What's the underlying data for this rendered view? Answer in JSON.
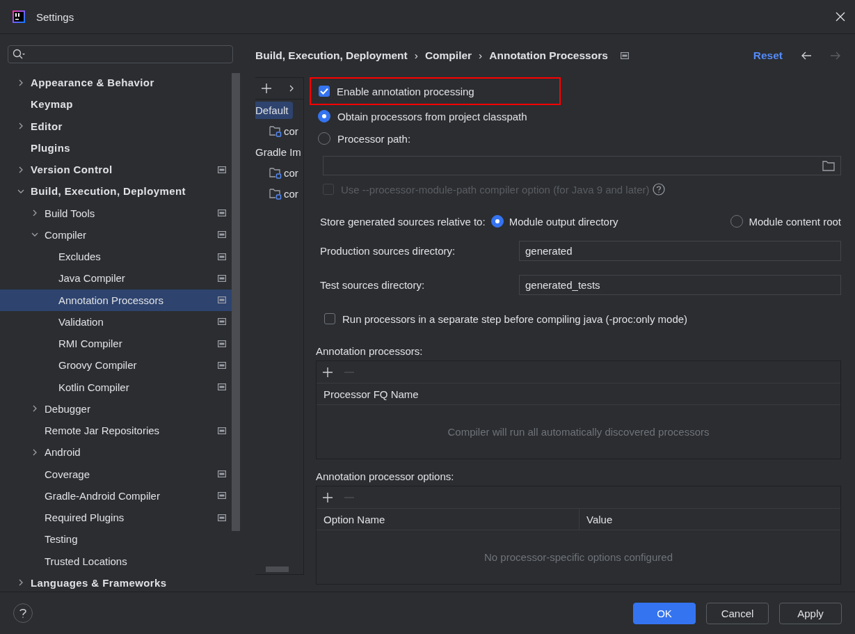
{
  "window": {
    "title": "Settings"
  },
  "sidebar": {
    "items": [
      {
        "label": "Appearance & Behavior",
        "expanded": false,
        "project_level": false,
        "selected": false
      },
      {
        "label": "Keymap",
        "project_level": false,
        "selected": false
      },
      {
        "label": "Editor",
        "expanded": false,
        "project_level": false,
        "selected": false
      },
      {
        "label": "Plugins",
        "project_level": false,
        "selected": false
      },
      {
        "label": "Version Control",
        "expanded": false,
        "project_level": true,
        "selected": false
      },
      {
        "label": "Build, Execution, Deployment",
        "expanded": true,
        "project_level": false,
        "selected": false,
        "children": [
          {
            "label": "Build Tools",
            "expanded": false,
            "project_level": true,
            "selected": false
          },
          {
            "label": "Compiler",
            "expanded": true,
            "project_level": true,
            "selected": false,
            "children": [
              {
                "label": "Excludes",
                "project_level": true,
                "selected": false
              },
              {
                "label": "Java Compiler",
                "project_level": true,
                "selected": false
              },
              {
                "label": "Annotation Processors",
                "project_level": true,
                "selected": true
              },
              {
                "label": "Validation",
                "project_level": true,
                "selected": false
              },
              {
                "label": "RMI Compiler",
                "project_level": true,
                "selected": false
              },
              {
                "label": "Groovy Compiler",
                "project_level": true,
                "selected": false
              },
              {
                "label": "Kotlin Compiler",
                "project_level": true,
                "selected": false
              }
            ]
          },
          {
            "label": "Debugger",
            "expanded": false,
            "project_level": false,
            "selected": false
          },
          {
            "label": "Remote Jar Repositories",
            "project_level": true,
            "selected": false
          },
          {
            "label": "Android",
            "expanded": false,
            "project_level": false,
            "selected": false
          },
          {
            "label": "Coverage",
            "project_level": true,
            "selected": false
          },
          {
            "label": "Gradle-Android Compiler",
            "project_level": true,
            "selected": false
          },
          {
            "label": "Required Plugins",
            "project_level": true,
            "selected": false
          },
          {
            "label": "Testing",
            "project_level": false,
            "selected": false
          },
          {
            "label": "Trusted Locations",
            "project_level": false,
            "selected": false
          }
        ]
      },
      {
        "label": "Languages & Frameworks",
        "expanded": false,
        "project_level": false,
        "selected": false
      }
    ]
  },
  "breadcrumb": {
    "parts": [
      "Build, Execution, Deployment",
      "Compiler",
      "Annotation Processors"
    ],
    "separator": "›",
    "project_level": true
  },
  "reset": "Reset",
  "navigation": {
    "back_disabled": false,
    "forward_disabled": true
  },
  "profiles": [
    {
      "label": "Default",
      "kind": "profile",
      "selected": true
    },
    {
      "label": "cor",
      "kind": "module",
      "selected": false
    },
    {
      "label": "Gradle Im",
      "kind": "profile",
      "selected": false
    },
    {
      "label": "cor",
      "kind": "module",
      "selected": false
    },
    {
      "label": "cor",
      "kind": "module",
      "selected": false
    }
  ],
  "enable_processing": {
    "label": "Enable annotation processing",
    "checked": true,
    "highlighted": true
  },
  "processor_source": [
    {
      "label": "Obtain processors from project classpath",
      "selected": true
    },
    {
      "label": "Processor path:",
      "selected": false
    }
  ],
  "module_path_option": {
    "label": "Use --processor-module-path compiler option (for Java 9 and later)",
    "checked": false,
    "disabled": true
  },
  "store_generated": {
    "label": "Store generated sources relative to:",
    "options": [
      {
        "label": "Module output directory",
        "selected": true
      },
      {
        "label": "Module content root",
        "selected": false
      }
    ]
  },
  "production_dir": {
    "label": "Production sources directory:",
    "value": "generated"
  },
  "test_dir": {
    "label": "Test sources directory:",
    "value": "generated_tests"
  },
  "separate_step": {
    "label": "Run processors in a separate step before compiling java (-proc:only mode)",
    "checked": false
  },
  "processors_table": {
    "title": "Annotation processors:",
    "remove_disabled": true,
    "columns": [
      "Processor FQ Name"
    ],
    "empty_text": "Compiler will run all automatically discovered processors"
  },
  "options_table": {
    "title": "Annotation processor options:",
    "remove_disabled": true,
    "columns": [
      "Option Name",
      "Value"
    ],
    "empty_text": "No processor-specific options configured"
  },
  "buttons": [
    {
      "label": "OK",
      "kind": "primary"
    },
    {
      "label": "Cancel",
      "kind": "normal"
    },
    {
      "label": "Apply",
      "kind": "normal"
    }
  ]
}
